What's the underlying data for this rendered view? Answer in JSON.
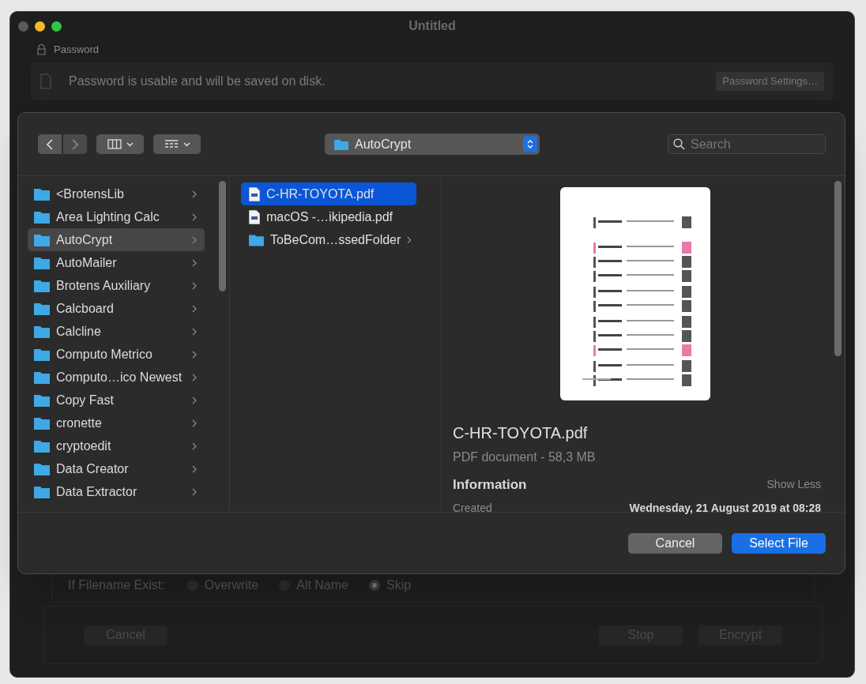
{
  "window": {
    "title": "Untitled"
  },
  "password": {
    "label": "Password",
    "message": "Password is usable and will be saved on disk.",
    "settings_button": "Password Settings…"
  },
  "toolbar": {
    "location": "AutoCrypt",
    "search": {
      "placeholder": "Search"
    }
  },
  "folders": [
    {
      "name": "<BrotensLib",
      "selected": false
    },
    {
      "name": "Area Lighting Calc",
      "selected": false
    },
    {
      "name": "AutoCrypt",
      "selected": true
    },
    {
      "name": "AutoMailer",
      "selected": false
    },
    {
      "name": "Brotens Auxiliary",
      "selected": false
    },
    {
      "name": "Calcboard",
      "selected": false
    },
    {
      "name": "Calcline",
      "selected": false
    },
    {
      "name": "Computo Metrico",
      "selected": false
    },
    {
      "name": "Computo…ico Newest",
      "selected": false
    },
    {
      "name": "Copy Fast",
      "selected": false
    },
    {
      "name": "cronette",
      "selected": false
    },
    {
      "name": "cryptoedit",
      "selected": false
    },
    {
      "name": "Data Creator",
      "selected": false
    },
    {
      "name": "Data Extractor",
      "selected": false
    }
  ],
  "files": [
    {
      "name": "C-HR-TOYOTA.pdf",
      "kind": "pdf",
      "selected": true
    },
    {
      "name": "macOS -…ikipedia.pdf",
      "kind": "pdf",
      "selected": false
    },
    {
      "name": "ToBeCom…ssedFolder",
      "kind": "folder",
      "selected": false
    }
  ],
  "preview": {
    "name": "C-HR-TOYOTA.pdf",
    "type": "PDF document - 58,3 MB",
    "info_heading": "Information",
    "toggle": "Show Less",
    "fields": [
      {
        "label": "Created",
        "value": "Wednesday, 21 August 2019 at 08:28"
      }
    ]
  },
  "buttons": {
    "cancel": "Cancel",
    "select": "Select File"
  },
  "background": {
    "exist_label": "If Filename Exist:",
    "options": [
      {
        "label": "Overwrite",
        "selected": false
      },
      {
        "label": "Alt Name",
        "selected": false
      },
      {
        "label": "Skip",
        "selected": true
      }
    ],
    "buttons": [
      "Cancel",
      "Stop",
      "Encrypt"
    ]
  }
}
